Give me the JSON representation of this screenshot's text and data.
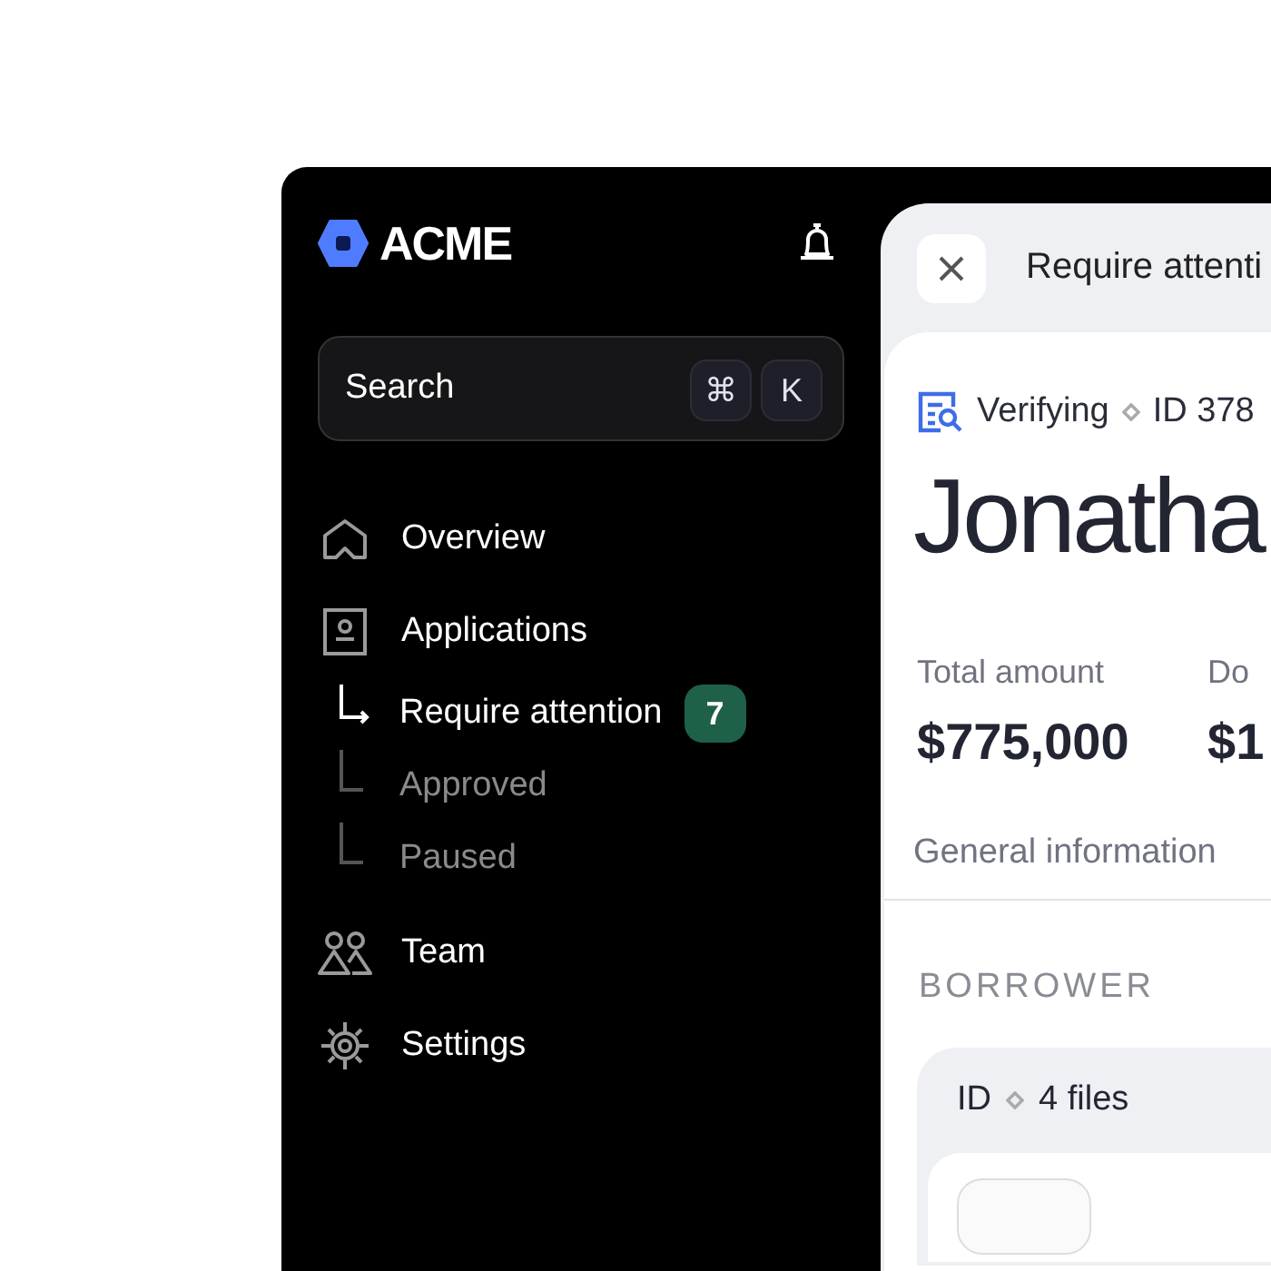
{
  "sidebar": {
    "logo": "ACME",
    "search": {
      "placeholder": "Search",
      "shortcut_keys": [
        "⌘",
        "K"
      ]
    },
    "nav": [
      {
        "label": "Overview",
        "kind": "home"
      },
      {
        "label": "Applications",
        "kind": "document",
        "children": [
          {
            "label": "Require attention",
            "selected": true,
            "badge": "7"
          },
          {
            "label": "Approved",
            "selected": false
          },
          {
            "label": "Paused",
            "selected": false
          }
        ]
      },
      {
        "label": "Team",
        "kind": "team"
      },
      {
        "label": "Settings",
        "kind": "settings"
      }
    ]
  },
  "panel": {
    "title": "Require attenti",
    "status": "Verifying",
    "id": "ID 378",
    "name": "Jonatha",
    "stats": [
      {
        "label": "Total amount",
        "value": "$775,000"
      },
      {
        "label": "Do",
        "value": "$1"
      }
    ],
    "tabs": [
      "General information"
    ],
    "section": "BORROWER",
    "files_card": {
      "title": "ID",
      "count": "4 files"
    }
  }
}
